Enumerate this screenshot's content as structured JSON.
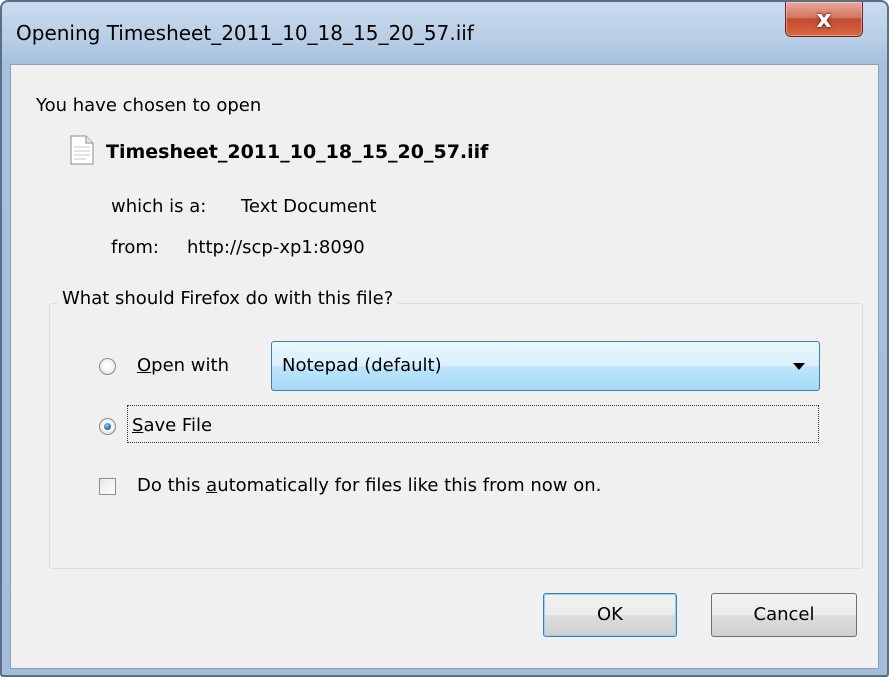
{
  "window": {
    "title": "Opening Timesheet_2011_10_18_15_20_57.iif",
    "close_symbol": "x"
  },
  "dialog": {
    "chosen_text": "You have chosen to open",
    "file_icon": "text-document-icon",
    "filename": "Timesheet_2011_10_18_15_20_57.iif",
    "which_label": "which is a:",
    "which_value": "Text Document",
    "from_label": "from:",
    "from_value": "http://scp-xp1:8090"
  },
  "action_group": {
    "legend": "What should Firefox do with this file?",
    "open_with": {
      "mnemonic": "O",
      "rest": "pen with",
      "checked": false
    },
    "application_select": {
      "selected": "Notepad (default)"
    },
    "save_file": {
      "mnemonic": "S",
      "rest": "ave File",
      "checked": true
    },
    "auto_checkbox": {
      "prefix": "Do this ",
      "mnemonic": "a",
      "rest": "utomatically for files like this from now on.",
      "checked": false
    }
  },
  "buttons": {
    "ok": "OK",
    "cancel": "Cancel"
  },
  "colors": {
    "accent": "#3c7fb1",
    "close_red": "#c24a30"
  }
}
